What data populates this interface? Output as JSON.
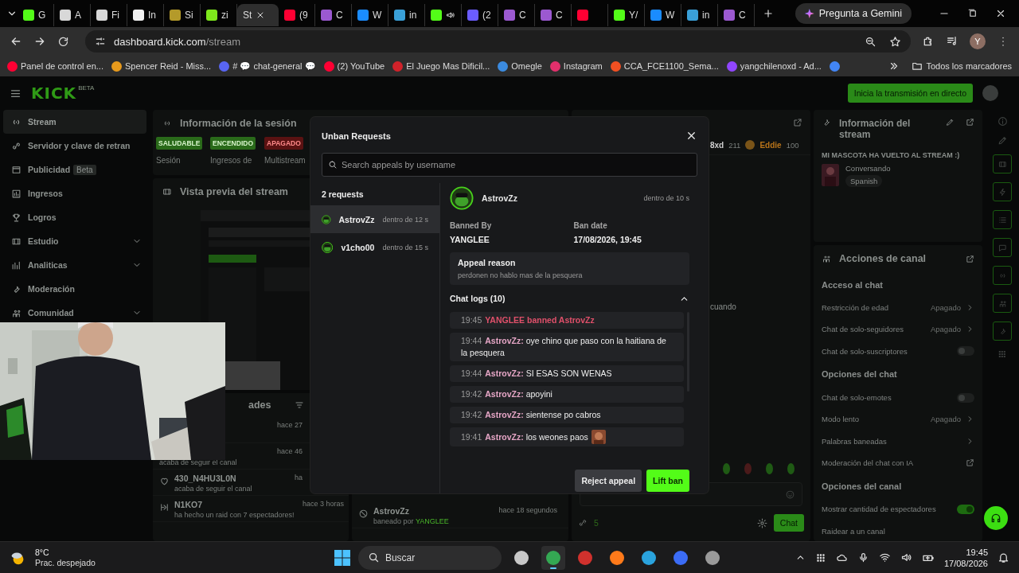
{
  "browser": {
    "tabs": [
      {
        "label": "G",
        "color": "#53fc18",
        "selected": false
      },
      {
        "label": "A",
        "color": "#d8d8d8",
        "selected": false
      },
      {
        "label": "Fi",
        "color": "#d8d8d8",
        "selected": false
      },
      {
        "label": "In",
        "color": "#f2f2f2",
        "selected": false
      },
      {
        "label": "Si",
        "color": "#b49a2a",
        "selected": false
      },
      {
        "label": "zi",
        "color": "#7ee81c",
        "selected": false
      },
      {
        "label": "St",
        "selected": true
      },
      {
        "label": "(9",
        "color": "#ff0033",
        "selected": false
      },
      {
        "label": "C",
        "color": "#9b59d0",
        "selected": false
      },
      {
        "label": "W",
        "color": "#1a8cff",
        "selected": false
      },
      {
        "label": "in",
        "color": "#3aa0d8",
        "selected": false
      },
      {
        "color": "#53fc18",
        "audio": true,
        "selected": false
      },
      {
        "label": "(2",
        "color": "#6b5cff",
        "selected": false
      },
      {
        "label": "C",
        "color": "#9b59d0",
        "selected": false
      },
      {
        "label": "C",
        "color": "#9b59d0",
        "selected": false
      },
      {
        "color": "#ff0033",
        "selected": false
      },
      {
        "label": "Y/",
        "color": "#53fc18",
        "selected": false
      },
      {
        "label": "W",
        "color": "#1a8cff",
        "selected": false
      },
      {
        "label": "in",
        "color": "#3aa0d8",
        "selected": false
      },
      {
        "label": "C",
        "color": "#9b59d0",
        "selected": false
      }
    ],
    "gemini_button": "Pregunta a Gemini",
    "address": {
      "host": "dashboard.kick.com",
      "path": "/stream"
    },
    "profile_initial": "Y",
    "bookmarks": [
      {
        "label": "Panel de control en...",
        "color": "#ff0033"
      },
      {
        "label": "Spencer Reid - Miss...",
        "color": "#e89a1c"
      },
      {
        "label": "# 💬 chat-general 💬",
        "color": "#5865f2"
      },
      {
        "label": "(2) YouTube",
        "color": "#ff0033"
      },
      {
        "label": "El Juego Mas Dificil...",
        "color": "#d0222a"
      },
      {
        "label": "Omegle",
        "color": "#3b8be0"
      },
      {
        "label": "Instagram",
        "color": "#e1306c"
      },
      {
        "label": "CCA_FCE1100_Sema...",
        "color": "#f25022"
      },
      {
        "label": "yangchilenoxd - Ad...",
        "color": "#9146ff"
      },
      {
        "color": "#4285f4"
      }
    ],
    "all_bookmarks": "Todos los marcadores"
  },
  "dashboard": {
    "logo": "KICK",
    "logo_badge": "BETA",
    "go_live_button": "Inicia la transmisión en directo",
    "sidebar": [
      {
        "label": "Stream",
        "selected": true,
        "expandable": false
      },
      {
        "label": "Servidor y clave de retran",
        "selected": false,
        "expandable": false
      },
      {
        "label": "Publicidad",
        "tag": "Beta",
        "selected": false,
        "expandable": false
      },
      {
        "label": "Ingresos",
        "selected": false,
        "expandable": false
      },
      {
        "label": "Logros",
        "selected": false,
        "expandable": false
      },
      {
        "label": "Estudio",
        "selected": false,
        "expandable": true
      },
      {
        "label": "Analiticas",
        "selected": false,
        "expandable": true
      },
      {
        "label": "Moderación",
        "selected": false,
        "expandable": false
      },
      {
        "label": "Comunidad",
        "selected": false,
        "expandable": true
      }
    ],
    "session": {
      "title": "Información de la sesión",
      "stats": [
        {
          "badge": "SALUDABLE",
          "kind": "ok",
          "color": "#2a6a1a",
          "label": "Sesión"
        },
        {
          "badge": "ENCENDIDO",
          "kind": "ok",
          "color": "#2a6a1a",
          "label": "Ingresos de"
        },
        {
          "badge": "APAGADO",
          "kind": "error",
          "color": "#5a1212",
          "label": "Multistream"
        }
      ]
    },
    "preview": {
      "title": "Vista previa del stream"
    },
    "activity": {
      "title": "ades",
      "items": [
        {
          "kind": "hidden",
          "time": "hace 27"
        },
        {
          "kind": "hidden",
          "time": "hace 46",
          "text": "acaba de seguir el canal"
        },
        {
          "kind": "follow",
          "name": "430_N4HU3L0N",
          "time": "ha",
          "text": "acaba de seguir el canal"
        },
        {
          "kind": "raid",
          "name": "N1KO7",
          "time": "hace 3 horas",
          "text": "ha hecho un raid con 7 espectadores!"
        }
      ]
    },
    "mod_log": {
      "items": [
        {
          "kind": "ban",
          "name": "AstrovZz",
          "time": "hace 18 segundos",
          "text": "baneado por",
          "actor": "YANGLEE"
        }
      ]
    },
    "chat": {
      "leaderboard": [
        {
          "name": "8xd",
          "points": "211",
          "color": "#cfcfcf"
        },
        {
          "name": "Eddie",
          "points": "100",
          "color": "#b8741a"
        }
      ],
      "messages": [
        "cuando"
      ],
      "viewer_count": "5",
      "send_button": "Chat"
    },
    "stream_info": {
      "title": "Información del stream",
      "stream_title": "MI MASCOTA HA VUELTO AL STREAM :)",
      "category": "Conversando",
      "tags": [
        "Spanish"
      ]
    },
    "channel_actions": {
      "title": "Acciones de canal",
      "rows": [
        {
          "kind": "heading",
          "label": "Acceso al chat"
        },
        {
          "kind": "setting",
          "label": "Restricción de edad",
          "value": "Apagado"
        },
        {
          "kind": "setting",
          "label": "Chat de solo-seguidores",
          "value": "Apagado"
        },
        {
          "kind": "toggle",
          "label": "Chat de solo-suscriptores",
          "on": false
        },
        {
          "kind": "heading",
          "label": "Opciones del chat"
        },
        {
          "kind": "toggle",
          "label": "Chat de solo-emotes",
          "on": false
        },
        {
          "kind": "setting",
          "label": "Modo lento",
          "value": "Apagado"
        },
        {
          "kind": "link",
          "label": "Palabras baneadas"
        },
        {
          "kind": "external",
          "label": "Moderación del chat con IA"
        },
        {
          "kind": "heading",
          "label": "Opciones del canal"
        },
        {
          "kind": "toggle",
          "label": "Mostrar cantidad de espectadores",
          "on": true
        },
        {
          "kind": "plain",
          "label": "Raidear a un canal"
        }
      ]
    }
  },
  "unban_modal": {
    "title": "Unban Requests",
    "search": {
      "placeholder": "Search appeals by username"
    },
    "count": "2 requests",
    "requests": [
      {
        "name": "AstrovZz",
        "time": "dentro de 12 s",
        "selected": true
      },
      {
        "name": "v1cho00",
        "time": "dentro de 15 s",
        "selected": false
      }
    ],
    "detail": {
      "name": "AstrovZz",
      "time": "dentro de 10 s",
      "banned_by_label": "Banned By",
      "banned_by": "YANGLEE",
      "ban_date_label": "Ban date",
      "ban_date": "17/08/2026, 19:45",
      "appeal_label": "Appeal reason",
      "appeal_text": "perdonen no hablo mas de la pesquera",
      "chat_logs_title": "Chat logs (10)",
      "chat_logs_expanded": true,
      "chat_logs": [
        {
          "kind": "ban",
          "time": "19:45",
          "text": "YANGLEE banned AstrovZz"
        },
        {
          "kind": "message",
          "time": "19:44",
          "user": "AstrovZz:",
          "text": "oye chino que paso con la haitiana de la pesquera",
          "emote": false
        },
        {
          "kind": "message",
          "time": "19:44",
          "user": "AstrovZz:",
          "text": "SI ESAS SON WENAS",
          "emote": false
        },
        {
          "kind": "message",
          "time": "19:42",
          "user": "AstrovZz:",
          "text": "apoyini",
          "emote": false
        },
        {
          "kind": "message",
          "time": "19:42",
          "user": "AstrovZz:",
          "text": "sientense po cabros",
          "emote": false
        },
        {
          "kind": "message",
          "time": "19:41",
          "user": "AstrovZz:",
          "text": "los weones paos",
          "emote": true
        }
      ]
    },
    "buttons": [
      {
        "kind": "secondary",
        "label": "Reject appeal"
      },
      {
        "kind": "primary",
        "label": "Lift ban"
      }
    ]
  },
  "taskbar": {
    "weather": {
      "temp": "8°C",
      "text": "Prac. despejado"
    },
    "search_placeholder": "Buscar",
    "apps": [
      {
        "color": "#c8c8c8",
        "selected": false
      },
      {
        "color": "#34a853",
        "selected": true
      },
      {
        "color": "#d0312d",
        "selected": false
      },
      {
        "color": "#ff7a1a",
        "selected": false
      },
      {
        "color": "#2aa3dd",
        "selected": false
      },
      {
        "color": "#3b6cf6",
        "selected": false
      },
      {
        "color": "#9a9a9a",
        "selected": false
      }
    ],
    "time": "19:45",
    "date": "17/08/2026"
  }
}
